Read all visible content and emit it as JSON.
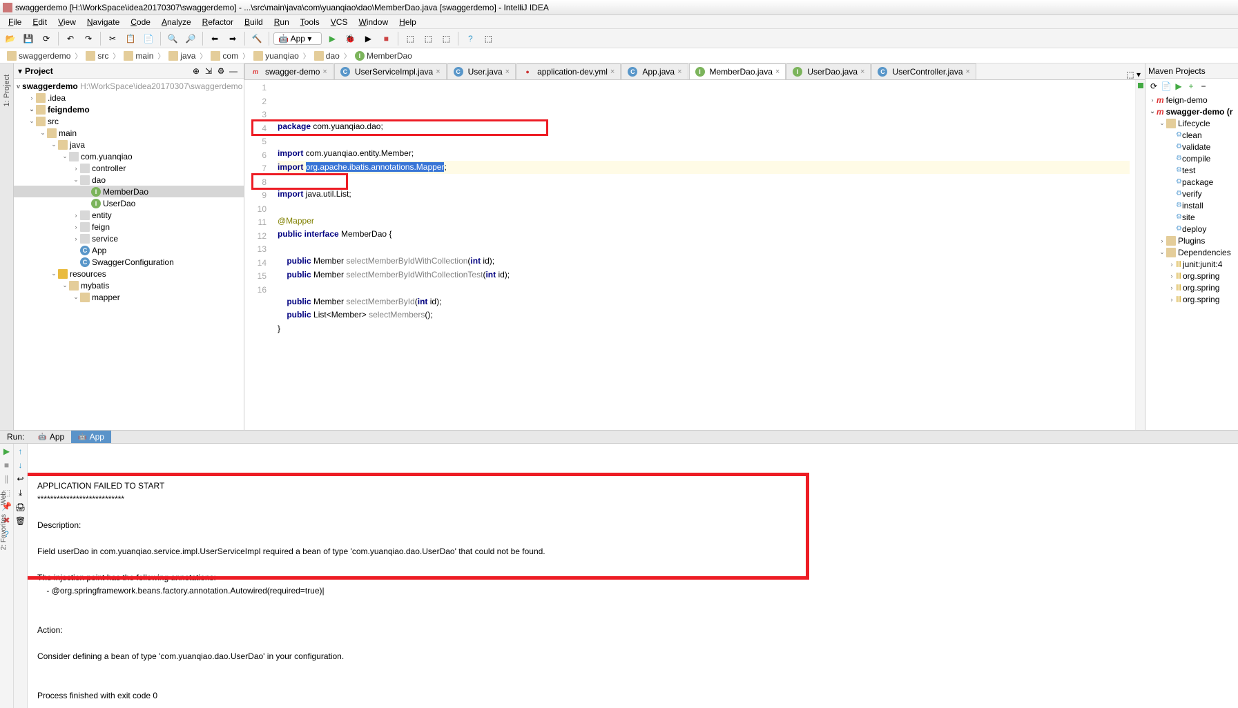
{
  "window": {
    "title": "swaggerdemo [H:\\WorkSpace\\idea20170307\\swaggerdemo] - ...\\src\\main\\java\\com\\yuanqiao\\dao\\MemberDao.java [swaggerdemo] - IntelliJ IDEA"
  },
  "menubar": [
    "File",
    "Edit",
    "View",
    "Navigate",
    "Code",
    "Analyze",
    "Refactor",
    "Build",
    "Run",
    "Tools",
    "VCS",
    "Window",
    "Help"
  ],
  "run_config": "App",
  "breadcrumbs": [
    {
      "icon": "folder",
      "label": "swaggerdemo"
    },
    {
      "icon": "folder",
      "label": "src"
    },
    {
      "icon": "folder",
      "label": "main"
    },
    {
      "icon": "folder",
      "label": "java"
    },
    {
      "icon": "folder",
      "label": "com"
    },
    {
      "icon": "folder",
      "label": "yuanqiao"
    },
    {
      "icon": "folder",
      "label": "dao"
    },
    {
      "icon": "iface",
      "label": "MemberDao"
    }
  ],
  "project": {
    "header": "Project",
    "root": {
      "label": "swaggerdemo",
      "path": "H:\\WorkSpace\\idea20170307\\swaggerdemo"
    },
    "tree": [
      {
        "depth": 1,
        "tw": ">",
        "icon": "folder",
        "label": ".idea"
      },
      {
        "depth": 1,
        "tw": "v",
        "icon": "folder",
        "label": "feigndemo",
        "bold": true
      },
      {
        "depth": 1,
        "tw": "v",
        "icon": "folder",
        "label": "src"
      },
      {
        "depth": 2,
        "tw": "v",
        "icon": "folder",
        "label": "main"
      },
      {
        "depth": 3,
        "tw": "v",
        "icon": "folder",
        "label": "java"
      },
      {
        "depth": 4,
        "tw": "v",
        "icon": "pkg",
        "label": "com.yuanqiao"
      },
      {
        "depth": 5,
        "tw": ">",
        "icon": "pkg",
        "label": "controller"
      },
      {
        "depth": 5,
        "tw": "v",
        "icon": "pkg",
        "label": "dao"
      },
      {
        "depth": 6,
        "tw": "",
        "icon": "iface",
        "label": "MemberDao",
        "selected": true
      },
      {
        "depth": 6,
        "tw": "",
        "icon": "iface",
        "label": "UserDao"
      },
      {
        "depth": 5,
        "tw": ">",
        "icon": "pkg",
        "label": "entity"
      },
      {
        "depth": 5,
        "tw": ">",
        "icon": "pkg",
        "label": "feign"
      },
      {
        "depth": 5,
        "tw": ">",
        "icon": "pkg",
        "label": "service"
      },
      {
        "depth": 5,
        "tw": "",
        "icon": "cls",
        "label": "App"
      },
      {
        "depth": 5,
        "tw": "",
        "icon": "cls",
        "label": "SwaggerConfiguration"
      },
      {
        "depth": 3,
        "tw": "v",
        "icon": "res",
        "label": "resources"
      },
      {
        "depth": 4,
        "tw": "v",
        "icon": "folder",
        "label": "mybatis"
      },
      {
        "depth": 5,
        "tw": "v",
        "icon": "folder",
        "label": "mapper"
      }
    ]
  },
  "tabs": [
    {
      "icon": "m",
      "label": "swagger-demo",
      "active": false
    },
    {
      "icon": "cls",
      "label": "UserServiceImpl.java",
      "active": false
    },
    {
      "icon": "cls",
      "label": "User.java",
      "active": false
    },
    {
      "icon": "yml",
      "label": "application-dev.yml",
      "active": false
    },
    {
      "icon": "cls",
      "label": "App.java",
      "active": false
    },
    {
      "icon": "iface",
      "label": "MemberDao.java",
      "active": true
    },
    {
      "icon": "iface",
      "label": "UserDao.java",
      "active": false
    },
    {
      "icon": "cls",
      "label": "UserController.java",
      "active": false
    }
  ],
  "code": {
    "lines": [
      {
        "n": 1,
        "segs": [
          {
            "t": "package ",
            "c": "kw"
          },
          {
            "t": "com.yuanqiao.dao;",
            "c": "pkg-ref"
          }
        ]
      },
      {
        "n": 2,
        "segs": []
      },
      {
        "n": 3,
        "segs": [
          {
            "t": "import ",
            "c": "kw"
          },
          {
            "t": "com.yuanqiao.entity.Member;",
            "c": "pkg-ref"
          }
        ]
      },
      {
        "n": 4,
        "hl": true,
        "segs": [
          {
            "t": "import ",
            "c": "kw"
          },
          {
            "t": "org.apache.ibatis.annotations.Mapper",
            "c": "sel"
          },
          {
            "t": ";",
            "c": "pkg-ref"
          }
        ]
      },
      {
        "n": 5,
        "segs": []
      },
      {
        "n": 6,
        "segs": [
          {
            "t": "import ",
            "c": "kw"
          },
          {
            "t": "java.util.List;",
            "c": "pkg-ref"
          }
        ]
      },
      {
        "n": 7,
        "segs": []
      },
      {
        "n": 8,
        "segs": [
          {
            "t": "@Mapper",
            "c": "an"
          }
        ]
      },
      {
        "n": 9,
        "segs": [
          {
            "t": "public interface ",
            "c": "kw"
          },
          {
            "t": "MemberDao {",
            "c": "pkg-ref"
          }
        ]
      },
      {
        "n": 10,
        "segs": []
      },
      {
        "n": 11,
        "segs": [
          {
            "t": "    ",
            "c": ""
          },
          {
            "t": "public ",
            "c": "kw"
          },
          {
            "t": "Member ",
            "c": "pkg-ref"
          },
          {
            "t": "selectMemberByIdWithCollection",
            "c": "gray"
          },
          {
            "t": "(",
            "c": "pkg-ref"
          },
          {
            "t": "int ",
            "c": "kw"
          },
          {
            "t": "id);",
            "c": "pkg-ref"
          }
        ]
      },
      {
        "n": 12,
        "segs": [
          {
            "t": "    ",
            "c": ""
          },
          {
            "t": "public ",
            "c": "kw"
          },
          {
            "t": "Member ",
            "c": "pkg-ref"
          },
          {
            "t": "selectMemberByIdWithCollectionTest",
            "c": "gray"
          },
          {
            "t": "(",
            "c": "pkg-ref"
          },
          {
            "t": "int ",
            "c": "kw"
          },
          {
            "t": "id);",
            "c": "pkg-ref"
          }
        ]
      },
      {
        "n": 13,
        "segs": []
      },
      {
        "n": 14,
        "segs": [
          {
            "t": "    ",
            "c": ""
          },
          {
            "t": "public ",
            "c": "kw"
          },
          {
            "t": "Member ",
            "c": "pkg-ref"
          },
          {
            "t": "selectMemberById",
            "c": "gray"
          },
          {
            "t": "(",
            "c": "pkg-ref"
          },
          {
            "t": "int ",
            "c": "kw"
          },
          {
            "t": "id);",
            "c": "pkg-ref"
          }
        ]
      },
      {
        "n": 15,
        "segs": [
          {
            "t": "    ",
            "c": ""
          },
          {
            "t": "public ",
            "c": "kw"
          },
          {
            "t": "List<Member> ",
            "c": "pkg-ref"
          },
          {
            "t": "selectMembers",
            "c": "gray"
          },
          {
            "t": "();",
            "c": "pkg-ref"
          }
        ]
      },
      {
        "n": 16,
        "segs": [
          {
            "t": "}",
            "c": "pkg-ref"
          }
        ]
      }
    ]
  },
  "maven": {
    "header": "Maven Projects",
    "nodes": [
      {
        "depth": 0,
        "tw": ">",
        "icon": "m",
        "label": "feign-demo"
      },
      {
        "depth": 0,
        "tw": "v",
        "icon": "m",
        "label": "swagger-demo (r",
        "bold": true
      },
      {
        "depth": 1,
        "tw": "v",
        "icon": "folder",
        "label": "Lifecycle"
      },
      {
        "depth": 2,
        "tw": "",
        "icon": "gear",
        "label": "clean"
      },
      {
        "depth": 2,
        "tw": "",
        "icon": "gear",
        "label": "validate"
      },
      {
        "depth": 2,
        "tw": "",
        "icon": "gear",
        "label": "compile"
      },
      {
        "depth": 2,
        "tw": "",
        "icon": "gear",
        "label": "test"
      },
      {
        "depth": 2,
        "tw": "",
        "icon": "gear",
        "label": "package"
      },
      {
        "depth": 2,
        "tw": "",
        "icon": "gear",
        "label": "verify"
      },
      {
        "depth": 2,
        "tw": "",
        "icon": "gear",
        "label": "install"
      },
      {
        "depth": 2,
        "tw": "",
        "icon": "gear",
        "label": "site"
      },
      {
        "depth": 2,
        "tw": "",
        "icon": "gear",
        "label": "deploy"
      },
      {
        "depth": 1,
        "tw": ">",
        "icon": "folder",
        "label": "Plugins"
      },
      {
        "depth": 1,
        "tw": "v",
        "icon": "folder",
        "label": "Dependencies"
      },
      {
        "depth": 2,
        "tw": ">",
        "icon": "lib",
        "label": "junit:junit:4"
      },
      {
        "depth": 2,
        "tw": ">",
        "icon": "lib",
        "label": "org.spring"
      },
      {
        "depth": 2,
        "tw": ">",
        "icon": "lib",
        "label": "org.spring"
      },
      {
        "depth": 2,
        "tw": ">",
        "icon": "lib",
        "label": "org.spring"
      }
    ]
  },
  "run": {
    "label": "Run:",
    "tabs": [
      {
        "label": "App",
        "active": false
      },
      {
        "label": "App",
        "active": true
      }
    ],
    "console": [
      "APPLICATION FAILED TO START",
      "***************************",
      "",
      "Description:",
      "",
      "Field userDao in com.yuanqiao.service.impl.UserServiceImpl required a bean of type 'com.yuanqiao.dao.UserDao' that could not be found.",
      "",
      "The injection point has the following annotations:",
      "    - @org.springframework.beans.factory.annotation.Autowired(required=true)|",
      "",
      "",
      "Action:",
      "",
      "Consider defining a bean of type 'com.yuanqiao.dao.UserDao' in your configuration.",
      "",
      "",
      "Process finished with exit code 0"
    ]
  },
  "left_rail": {
    "items": [
      "1: Project"
    ]
  },
  "left_rail_bottom": {
    "items": [
      "Web",
      "2: Favorites"
    ]
  }
}
